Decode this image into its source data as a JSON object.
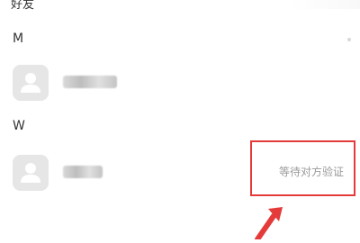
{
  "header": {
    "title": "好友"
  },
  "sections": [
    {
      "letter": "M"
    },
    {
      "letter": "W"
    }
  ],
  "contacts": [
    {
      "icon": "default-avatar-icon"
    },
    {
      "icon": "default-avatar-icon",
      "status": "等待对方验证"
    }
  ],
  "annotation": {
    "color": "#e53a3a",
    "icon": "red-arrow-icon"
  }
}
